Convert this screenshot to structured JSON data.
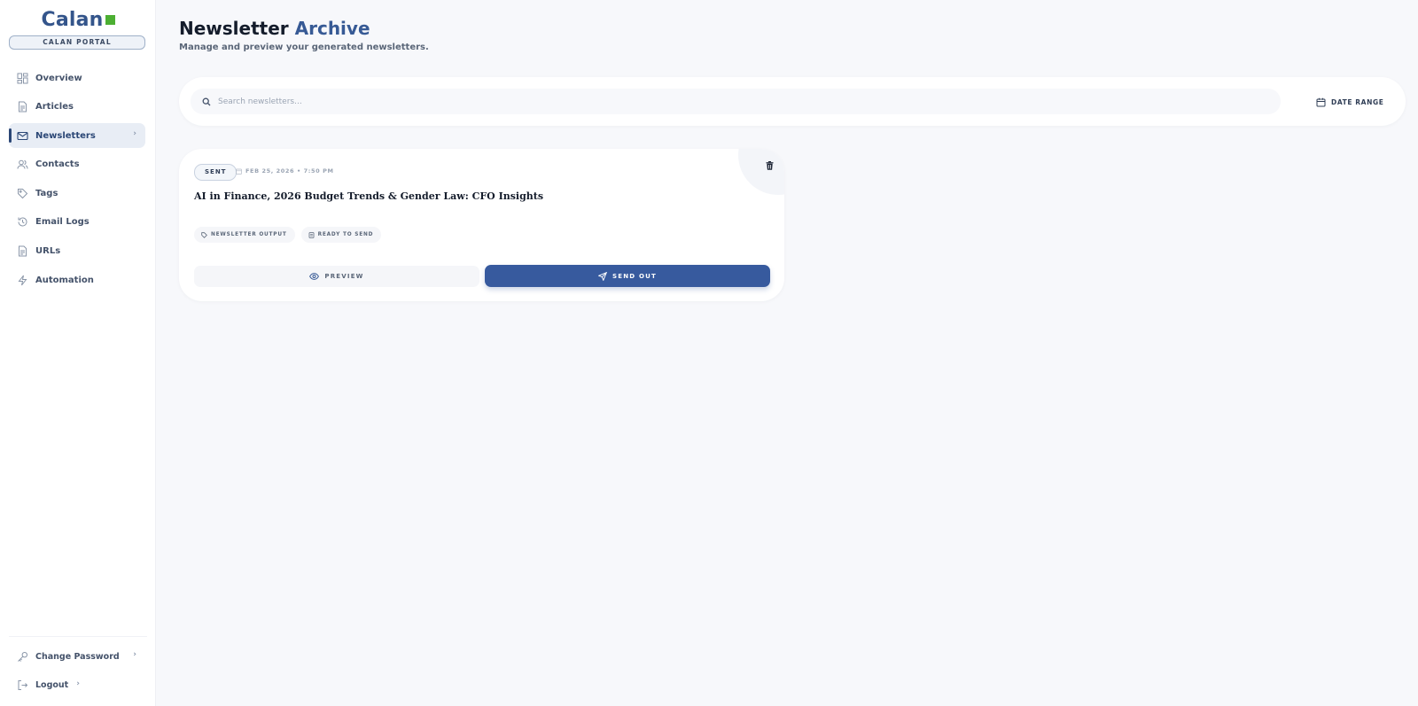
{
  "brand": {
    "name": "Calan",
    "portal_label": "CALAN PORTAL",
    "accent_color": "#375a95",
    "logo_square_color": "#4caf32"
  },
  "sidebar": {
    "items": [
      {
        "label": "Overview",
        "icon": "grid-icon"
      },
      {
        "label": "Articles",
        "icon": "document-icon"
      },
      {
        "label": "Newsletters",
        "icon": "mail-icon",
        "active": true
      },
      {
        "label": "Contacts",
        "icon": "users-icon"
      },
      {
        "label": "Tags",
        "icon": "tag-icon"
      },
      {
        "label": "Email Logs",
        "icon": "history-icon"
      },
      {
        "label": "URLs",
        "icon": "document-icon"
      },
      {
        "label": "Automation",
        "icon": "lightning-icon"
      }
    ],
    "bottom": [
      {
        "label": "Change Password",
        "icon": "key-icon"
      },
      {
        "label": "Logout",
        "icon": "logout-icon"
      }
    ]
  },
  "header": {
    "title_main": "Newsletter",
    "title_accent": "Archive",
    "subtitle": "Manage and preview your generated newsletters."
  },
  "filters": {
    "search_placeholder": "Search newsletters...",
    "date_range_label": "DATE RANGE"
  },
  "newsletters": [
    {
      "status": "SENT",
      "date": "FEB 25, 2026 • 7:50 PM",
      "title": "AI in Finance, 2026 Budget Trends & Gender Law: CFO Insights",
      "tags": [
        "NEWSLETTER OUTPUT",
        "READY TO SEND"
      ],
      "preview_label": "PREVIEW",
      "send_label": "SEND OUT"
    }
  ]
}
